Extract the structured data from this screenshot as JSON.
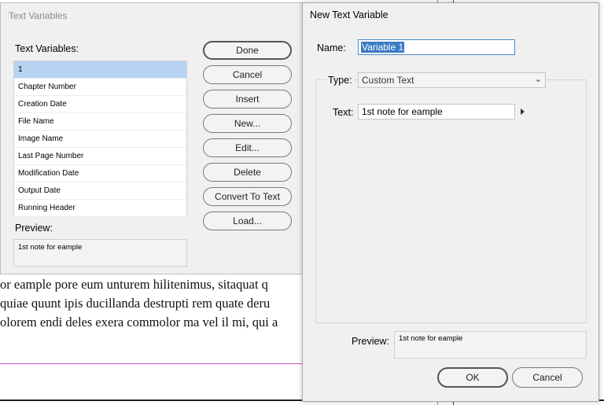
{
  "document": {
    "lines": [
      "or eample pore eum unturem hilitenimus, sitaquat q",
      "quiae quunt ipis ducillanda destrupti rem quate deru",
      "olorem endi deles exera commolor ma vel il mi, qui a"
    ]
  },
  "text_variables_dialog": {
    "title": "Text Variables",
    "list_label": "Text Variables:",
    "variables": [
      "1",
      "Chapter Number",
      "Creation Date",
      "File Name",
      "Image Name",
      "Last Page Number",
      "Modification Date",
      "Output Date",
      "Running Header"
    ],
    "selected_index": 0,
    "preview_label": "Preview:",
    "preview_text": "1st note for eample",
    "buttons": {
      "done": "Done",
      "cancel": "Cancel",
      "insert": "Insert",
      "new": "New...",
      "edit": "Edit...",
      "delete": "Delete",
      "convert": "Convert To Text",
      "load": "Load..."
    }
  },
  "new_text_variable_dialog": {
    "title": "New Text Variable",
    "name_label": "Name:",
    "name_value": "Variable 1",
    "type_label": "Type:",
    "type_value": "Custom Text",
    "text_label": "Text:",
    "text_value": "1st note for eample",
    "preview_label": "Preview:",
    "preview_text": "1st note for eample",
    "ok_label": "OK",
    "cancel_label": "Cancel"
  },
  "colors": {
    "selection": "#b6d3f2",
    "name_highlight": "#3b79c5",
    "margin_guide": "#d64fd1"
  }
}
